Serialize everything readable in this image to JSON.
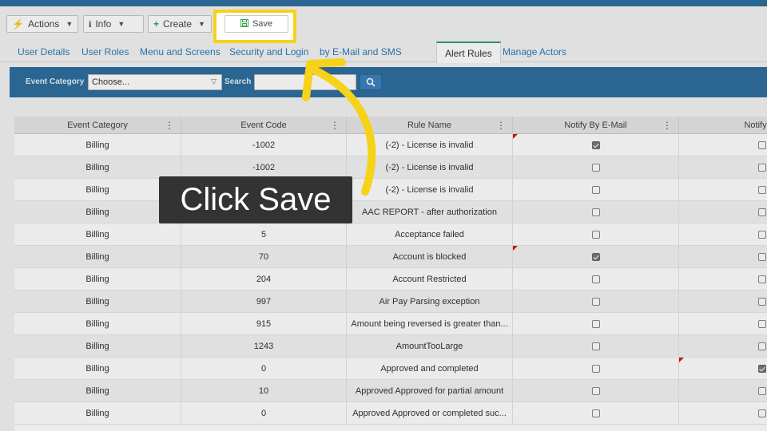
{
  "toolbar": {
    "actions_label": "Actions",
    "info_label": "Info",
    "create_label": "Create",
    "save_label": "Save"
  },
  "tabs": [
    {
      "label": "User Details"
    },
    {
      "label": "User Roles"
    },
    {
      "label": "Menu and Screens"
    },
    {
      "label": "Security and Login"
    },
    {
      "label": "by E-Mail and SMS"
    },
    {
      "label": "Alert Rules"
    },
    {
      "label": "Manage Actors"
    }
  ],
  "filters": {
    "event_category_label": "Event Category",
    "event_category_value": "Choose...",
    "search_label": "Search",
    "search_value": ""
  },
  "table": {
    "columns": [
      "Event Category",
      "Event Code",
      "Rule Name",
      "Notify By E-Mail",
      "Notify By"
    ],
    "rows": [
      {
        "category": "Billing",
        "code": "-1002",
        "rule": "(-2) - License is invalid",
        "email": true,
        "other": false,
        "flag_email": true,
        "flag_other": false
      },
      {
        "category": "Billing",
        "code": "-1002",
        "rule": "(-2) - License is invalid",
        "email": false,
        "other": false,
        "flag_email": false,
        "flag_other": false
      },
      {
        "category": "Billing",
        "code": "",
        "rule": "(-2) - License is invalid",
        "email": false,
        "other": false,
        "flag_email": false,
        "flag_other": false
      },
      {
        "category": "Billing",
        "code": "",
        "rule": "AAC REPORT - after authorization",
        "email": false,
        "other": false,
        "flag_email": false,
        "flag_other": false
      },
      {
        "category": "Billing",
        "code": "5",
        "rule": "Acceptance failed",
        "email": false,
        "other": false,
        "flag_email": false,
        "flag_other": false
      },
      {
        "category": "Billing",
        "code": "70",
        "rule": "Account is blocked",
        "email": true,
        "other": false,
        "flag_email": true,
        "flag_other": false
      },
      {
        "category": "Billing",
        "code": "204",
        "rule": "Account Restricted",
        "email": false,
        "other": false,
        "flag_email": false,
        "flag_other": false
      },
      {
        "category": "Billing",
        "code": "997",
        "rule": "Air Pay Parsing exception",
        "email": false,
        "other": false,
        "flag_email": false,
        "flag_other": false
      },
      {
        "category": "Billing",
        "code": "915",
        "rule": "Amount being reversed is greater than...",
        "email": false,
        "other": false,
        "flag_email": false,
        "flag_other": false
      },
      {
        "category": "Billing",
        "code": "1243",
        "rule": "AmountTooLarge",
        "email": false,
        "other": false,
        "flag_email": false,
        "flag_other": false
      },
      {
        "category": "Billing",
        "code": "0",
        "rule": "Approved and completed",
        "email": false,
        "other": true,
        "flag_email": false,
        "flag_other": true
      },
      {
        "category": "Billing",
        "code": "10",
        "rule": "Approved Approved for partial amount",
        "email": false,
        "other": false,
        "flag_email": false,
        "flag_other": false
      },
      {
        "category": "Billing",
        "code": "0",
        "rule": "Approved Approved or completed suc...",
        "email": false,
        "other": false,
        "flag_email": false,
        "flag_other": false
      }
    ]
  },
  "callout": {
    "text": "Click Save",
    "accent": "#f7d21a"
  },
  "icons": {
    "info": "info-icon",
    "create": "plus-icon",
    "save": "save-icon",
    "search": "magnifier-icon"
  }
}
